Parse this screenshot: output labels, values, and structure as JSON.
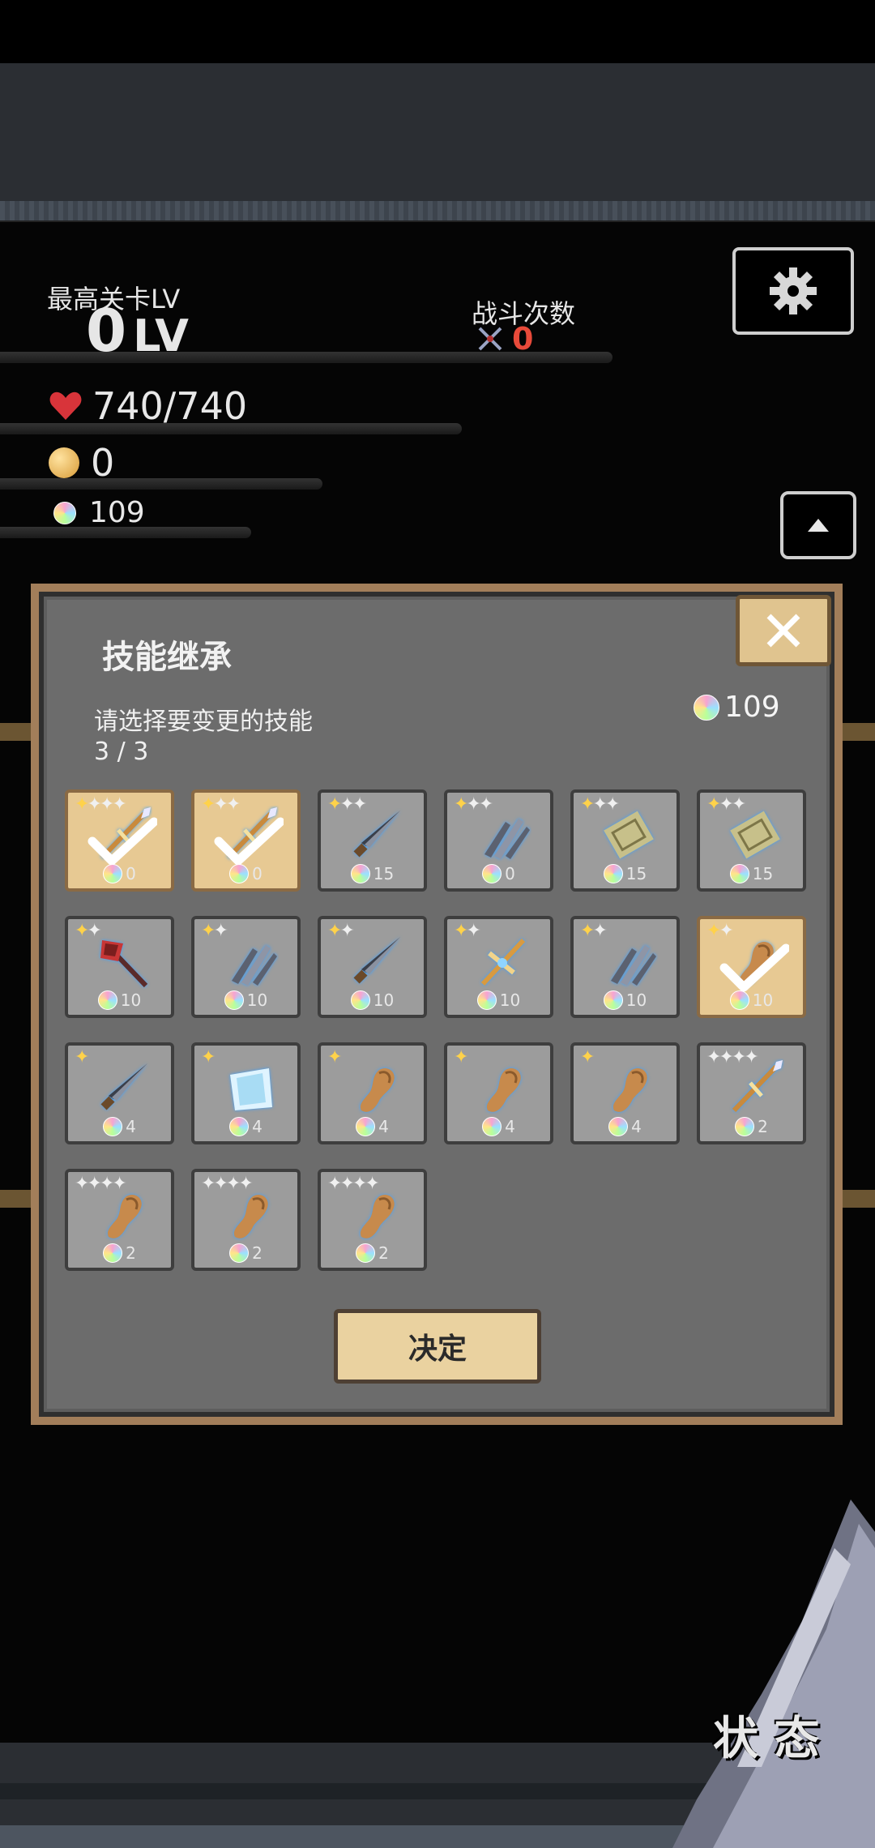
{
  "hud": {
    "max_stage_label": "最高关卡LV",
    "max_stage_value": "0",
    "max_stage_unit": "LV",
    "battle_count_label": "战斗次数",
    "battle_count_value": "0",
    "hp": "740/740",
    "gold": "0",
    "gems": "109"
  },
  "dialog": {
    "title": "技能继承",
    "subtitle": "请选择要变更的技能",
    "selection_count": "3 / 3",
    "gem_balance": "109",
    "confirm_label": "决定"
  },
  "skills": [
    {
      "icon": "spear-icon",
      "stars_gold": 1,
      "stars_white": 3,
      "cost": "0",
      "selected": true
    },
    {
      "icon": "spear-icon",
      "stars_gold": 1,
      "stars_white": 2,
      "cost": "0",
      "selected": true
    },
    {
      "icon": "dagger-icon",
      "stars_gold": 1,
      "stars_white": 2,
      "cost": "15",
      "selected": false
    },
    {
      "icon": "claw-icon",
      "stars_gold": 1,
      "stars_white": 2,
      "cost": "0",
      "selected": false
    },
    {
      "icon": "scroll-icon",
      "stars_gold": 1,
      "stars_white": 2,
      "cost": "15",
      "selected": false
    },
    {
      "icon": "scroll-icon",
      "stars_gold": 1,
      "stars_white": 2,
      "cost": "15",
      "selected": false
    },
    {
      "icon": "axe-icon",
      "stars_gold": 1,
      "stars_white": 1,
      "cost": "10",
      "selected": false
    },
    {
      "icon": "claw-icon",
      "stars_gold": 1,
      "stars_white": 1,
      "cost": "10",
      "selected": false
    },
    {
      "icon": "dagger-icon",
      "stars_gold": 1,
      "stars_white": 1,
      "cost": "10",
      "selected": false
    },
    {
      "icon": "cross-staff-icon",
      "stars_gold": 1,
      "stars_white": 1,
      "cost": "10",
      "selected": false
    },
    {
      "icon": "claw-icon",
      "stars_gold": 1,
      "stars_white": 1,
      "cost": "10",
      "selected": false
    },
    {
      "icon": "club-icon",
      "stars_gold": 1,
      "stars_white": 1,
      "cost": "10",
      "selected": true
    },
    {
      "icon": "dagger-icon",
      "stars_gold": 1,
      "stars_white": 0,
      "cost": "4",
      "selected": false
    },
    {
      "icon": "cloth-icon",
      "stars_gold": 1,
      "stars_white": 0,
      "cost": "4",
      "selected": false
    },
    {
      "icon": "club-icon",
      "stars_gold": 1,
      "stars_white": 0,
      "cost": "4",
      "selected": false
    },
    {
      "icon": "club-icon",
      "stars_gold": 1,
      "stars_white": 0,
      "cost": "4",
      "selected": false
    },
    {
      "icon": "club-icon",
      "stars_gold": 1,
      "stars_white": 0,
      "cost": "4",
      "selected": false
    },
    {
      "icon": "spear-icon",
      "stars_gold": 0,
      "stars_white": 4,
      "cost": "2",
      "selected": false
    },
    {
      "icon": "club-icon",
      "stars_gold": 0,
      "stars_white": 4,
      "cost": "2",
      "selected": false
    },
    {
      "icon": "club-icon",
      "stars_gold": 0,
      "stars_white": 4,
      "cost": "2",
      "selected": false
    },
    {
      "icon": "club-icon",
      "stars_gold": 0,
      "stars_white": 4,
      "cost": "2",
      "selected": false
    }
  ],
  "bottom": {
    "status_label": "状 态"
  },
  "colors": {
    "selected_card": "#e7c993",
    "card": "#9c9c9c",
    "dialog_border": "#a27e5a",
    "battle_count": "#e84a3a"
  }
}
